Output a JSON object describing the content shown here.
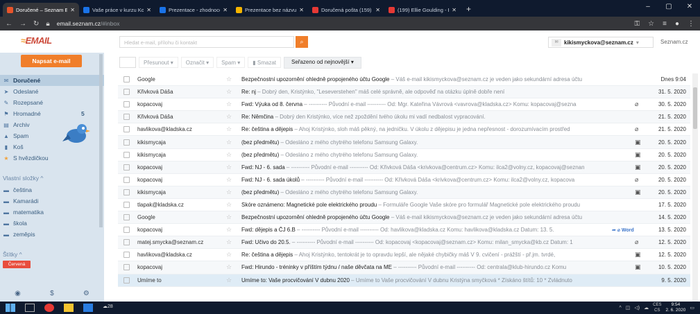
{
  "browser": {
    "tabs": [
      {
        "title": "Doručené – Seznam Email",
        "color": "#e8542b",
        "active": true
      },
      {
        "title": "Vaše práce v kurzu Komunik",
        "color": "#1a73e8"
      },
      {
        "title": "Prezentace - zhodnocení zp",
        "color": "#1a73e8"
      },
      {
        "title": "Prezentace bez názvu - Prez",
        "color": "#f4b400"
      },
      {
        "title": "Doručená pošta (159) - kiki",
        "color": "#e53935"
      },
      {
        "title": "(199) Ellie Goulding - Bu",
        "color": "#e53935"
      }
    ],
    "url_host": "email.seznam.cz",
    "url_path": "/#inbox"
  },
  "header": {
    "logo": "EMAIL",
    "search_placeholder": "Hledat e-mail, přílohu či kontakt",
    "account_email": "kikismyckova@seznam.cz",
    "settings_link": "Seznam.cz"
  },
  "sidebar": {
    "compose_label": "Napsat e-mail",
    "folders": [
      {
        "label": "Doručené",
        "icon": "inbox-icon",
        "glyph": "✉",
        "active": true
      },
      {
        "label": "Odeslané",
        "icon": "send-icon",
        "glyph": "➤"
      },
      {
        "label": "Rozepsané",
        "icon": "draft-icon",
        "glyph": "✎"
      },
      {
        "label": "Hromadné",
        "icon": "bulk-icon",
        "glyph": "⚑",
        "count": "5"
      },
      {
        "label": "Archiv",
        "icon": "archive-icon",
        "glyph": "▤"
      },
      {
        "label": "Spam",
        "icon": "spam-icon",
        "glyph": "▲"
      },
      {
        "label": "Koš",
        "icon": "trash-icon",
        "glyph": "▮"
      },
      {
        "label": "S hvězdičkou",
        "icon": "star-icon",
        "glyph": "★",
        "star": true
      }
    ],
    "custom_section": "Vlastní složky",
    "custom_folders": [
      "čeština",
      "Kamarádi",
      "matematika",
      "škola",
      "zeměpis"
    ],
    "labels_section": "Štítky",
    "tag_red": "Červená"
  },
  "toolbar": {
    "move": "Přesunout",
    "mark": "Označit",
    "spam": "Spam",
    "delete": "Smazat",
    "sort": "Seřazeno od nejnovější"
  },
  "emails": [
    {
      "sender": "Google",
      "subject": "Bezpečnostní upozornění ohledně propojeného účtu Google",
      "preview": " – Váš e-mail kikismyckova@seznam.cz je veden jako sekundární adresa účtu",
      "date": "Dnes 9:04"
    },
    {
      "sender": "Křivková Dáša",
      "subject": "Re: nj",
      "preview": " – Dobrý den, Kristýnko,      \"Leseverstehen\" máš celé správně, ale odpověď na otázku úplně dobře není",
      "date": "31. 5. 2020"
    },
    {
      "sender": "kopacovaj",
      "subject": "Fwd: Výuka od 8. června",
      "preview": " – ---------- Původní e-mail ---------- Od: Mgr. Kateřina Vávrová <vavrova@kladska.cz> Komu: kopacovaj@sezna",
      "date": "30. 5. 2020",
      "attach": "clip"
    },
    {
      "sender": "Křivková Dáša",
      "subject": "Re: Němčina",
      "preview": " – Dobrý den Kristýnko,      více než zpoždění tvého úkolu mi vadí nedbalost vypracování.",
      "date": "21. 5. 2020"
    },
    {
      "sender": "havlikova@kladska.cz",
      "subject": "Re: čeština a dějepis",
      "preview": " – Ahoj Kristýnko, sloh máš pěkný, na jedničku. V úkolu z dějepisu je jedna nepřesnost - dorozumívacím prostřed",
      "date": "21. 5. 2020",
      "attach": "clip"
    },
    {
      "sender": "kikismycaja",
      "subject": "(bez předmětu)",
      "preview": " – Odesláno z mého chytrého telefonu Samsung Galaxy.",
      "date": "20. 5. 2020",
      "attach": "image"
    },
    {
      "sender": "kikismycaja",
      "subject": "(bez předmětu)",
      "preview": " – Odesláno z mého chytrého telefonu Samsung Galaxy.",
      "date": "20. 5. 2020",
      "attach": "image"
    },
    {
      "sender": "kopacovaj",
      "subject": "Fwd: NJ - 6. sada",
      "preview": " – ---------- Původní e-mail ---------- Od: Křivková Dáša <krivkova@centrum.cz> Komu: ilca2@volny.cz, kopacovaj@seznan",
      "date": "20. 5. 2020",
      "attach": "image"
    },
    {
      "sender": "kopacovaj",
      "subject": "Fwd: NJ - 6. sada úkolů",
      "preview": " – ---------- Původní e-mail ---------- Od: Křivková Dáša <krivkova@centrum.cz> Komu: ilca2@volny.cz, kopacova",
      "date": "20. 5. 2020",
      "attach": "clip"
    },
    {
      "sender": "kikismycaja",
      "subject": "(bez předmětu)",
      "preview": " – Odesláno z mého chytrého telefonu Samsung Galaxy.",
      "date": "20. 5. 2020",
      "attach": "image"
    },
    {
      "sender": "tlapak@kladska.cz",
      "subject": "Skóre oznámeno: Magnetické pole elektrického proudu",
      "preview": " – Formuláře Google Vaše skóre pro formulář Magnetické pole elektrického proudu",
      "date": "17. 5. 2020"
    },
    {
      "sender": "Google",
      "subject": "Bezpečnostní upozornění ohledně propojeného účtu Google",
      "preview": " – Váš e-mail kikismyckova@seznam.cz je veden jako sekundární adresa účtu",
      "date": "14. 5. 2020"
    },
    {
      "sender": "kopacovaj",
      "subject": "Fwd: dějepis a ČJ 6.B",
      "preview": " – ---------- Původní e-mail ---------- Od: havlikova@kladska.cz Komu: havlikova@kladska.cz Datum: 13. 5.",
      "date": "13. 5. 2020",
      "attach": "word",
      "word_label": "Word"
    },
    {
      "sender": "matej.smycka@seznam.cz",
      "subject": "Fwd: Učivo do 20.5.",
      "preview": " – ---------- Původní e-mail ---------- Od: kopacovaj <kopacovaj@seznam.cz> Komu: milan_smycka@kb.cz Datum: 1",
      "date": "12. 5. 2020",
      "attach": "clip"
    },
    {
      "sender": "havlikova@kladska.cz",
      "subject": "Re: čeština a dějepis",
      "preview": " – Ahoj Kristýnko, tentokrát je to opravdu lepší, ale nějaké chybičky máš V 9. cvičení - prážští - př.jm. tvrdé,",
      "date": "12. 5. 2020",
      "attach": "image"
    },
    {
      "sender": "kopacovaj",
      "subject": "Fwd: Hirundo - tréninky v příštím týdnu / naše děvčata na ME",
      "preview": " – ---------- Původní e-mail ---------- Od: centrala@klub-hirundo.cz Komu",
      "date": "10. 5. 2020",
      "attach": "image"
    },
    {
      "sender": "Umíme to",
      "subject": "Umíme to: Vaše procvičování V dubnu 2020",
      "preview": " – Umíme to Vaše procvičování V dubnu Kristýna smyčková * Získáno štítů: 10 * Zvládnuto",
      "date": "9. 5. 2020"
    }
  ],
  "taskbar": {
    "weather": "28",
    "lang": "CES",
    "lang2": "CS",
    "time": "9:54",
    "date": "2. 6. 2020"
  }
}
